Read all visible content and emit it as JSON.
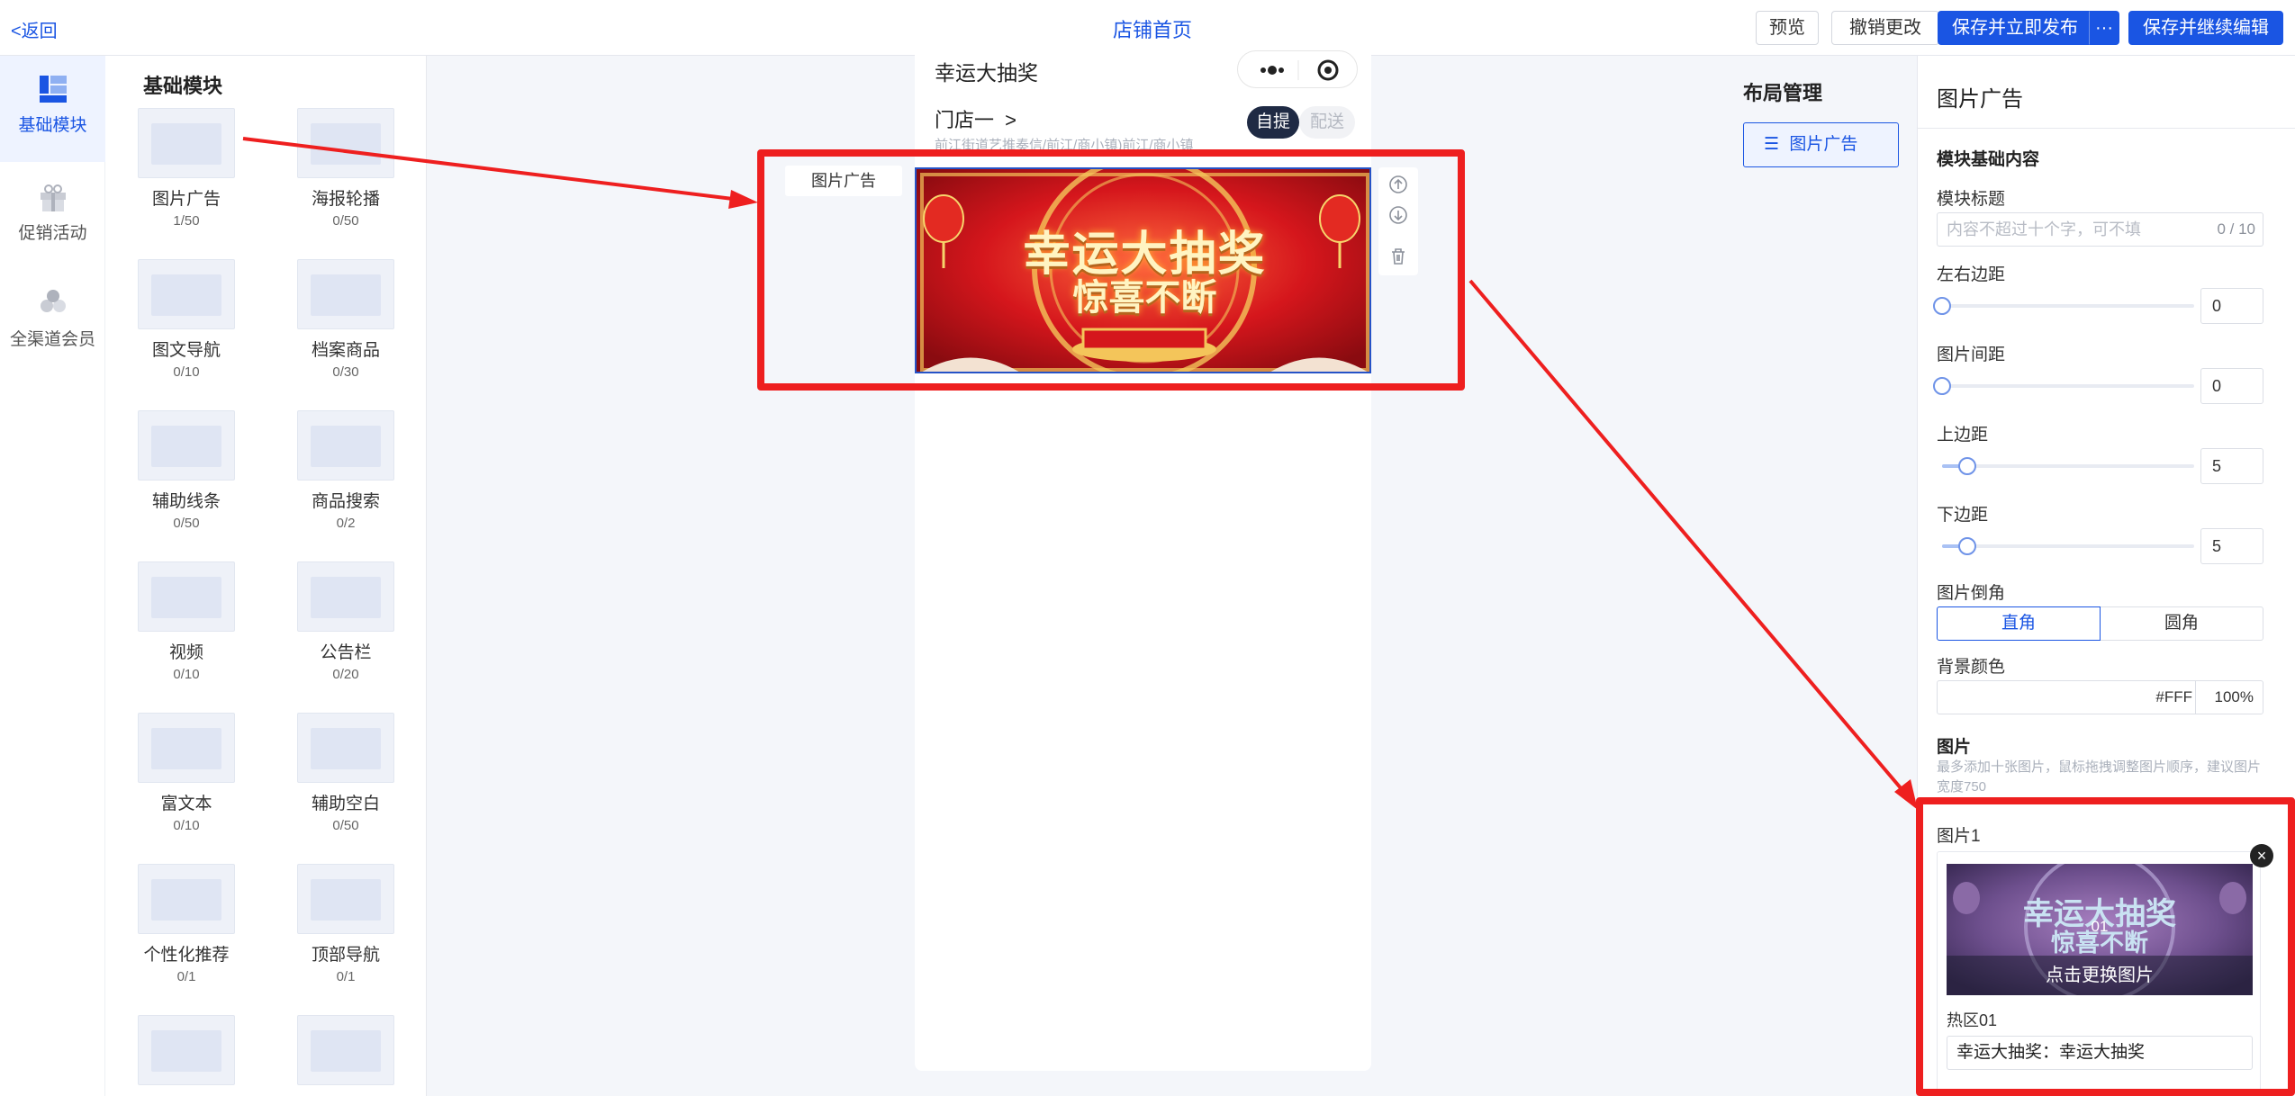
{
  "topbar": {
    "back": "<返回",
    "title": "店铺首页",
    "preview": "预览",
    "undo": "撤销更改",
    "save_publish": "保存并立即发布",
    "more": "···",
    "save_continue": "保存并继续编辑"
  },
  "rail": [
    {
      "label": "基础模块",
      "icon": "modules-icon"
    },
    {
      "label": "促销活动",
      "icon": "gift-icon"
    },
    {
      "label": "全渠道会员",
      "icon": "member-icon"
    }
  ],
  "modules": {
    "title": "基础模块",
    "items": [
      {
        "name": "图片广告",
        "count": "1/50"
      },
      {
        "name": "海报轮播",
        "count": "0/50"
      },
      {
        "name": "图文导航",
        "count": "0/10"
      },
      {
        "name": "档案商品",
        "count": "0/30"
      },
      {
        "name": "辅助线条",
        "count": "0/50"
      },
      {
        "name": "商品搜索",
        "count": "0/2"
      },
      {
        "name": "视频",
        "count": "0/10"
      },
      {
        "name": "公告栏",
        "count": "0/20"
      },
      {
        "name": "富文本",
        "count": "0/10"
      },
      {
        "name": "辅助空白",
        "count": "0/50"
      },
      {
        "name": "个性化推荐",
        "count": "0/1"
      },
      {
        "name": "顶部导航",
        "count": "0/1"
      },
      {
        "name": "",
        "count": ""
      },
      {
        "name": "",
        "count": ""
      }
    ]
  },
  "phone": {
    "title": "幸运大抽奖",
    "store": "门店一",
    "store_arrow": ">",
    "address": "前江街道艺推奏信/前江/商小镇)前江/商小镇",
    "pickup": "自提",
    "delivery": "配送",
    "ad_label": "图片广告",
    "banner_line1": "幸运大抽奖",
    "banner_line2": "惊喜不断"
  },
  "layout_manager": {
    "title": "布局管理",
    "item": "图片广告"
  },
  "settings": {
    "header": "图片广告",
    "section_basic": "模块基础内容",
    "module_title_label": "模块标题",
    "module_title_placeholder": "内容不超过十个字，可不填",
    "module_title_counter": "0 / 10",
    "lr_margin_label": "左右边距",
    "lr_margin_value": "0",
    "lr_margin_level": 0,
    "img_gap_label": "图片间距",
    "img_gap_value": "0",
    "img_gap_level": 0,
    "top_margin_label": "上边距",
    "top_margin_value": "5",
    "top_margin_level": 0.1,
    "bottom_margin_label": "下边距",
    "bottom_margin_value": "5",
    "bottom_margin_level": 0.1,
    "corner_label": "图片倒角",
    "corner_square": "直角",
    "corner_round": "圆角",
    "bg_label": "背景颜色",
    "bg_hex": "#FFF",
    "bg_opacity": "100%",
    "images_section": "图片",
    "images_hint": "最多添加十张图片，鼠标拖拽调整图片顺序，建议图片宽度750",
    "image1_label": "图片1",
    "image1_num": "01",
    "image1_change": "点击更换图片",
    "close": "×",
    "hotzone_label": "热区01",
    "hotzone_value": "幸运大抽奖：幸运大抽奖",
    "thumb_line1": "幸运大抽奖",
    "thumb_line2": "惊喜不断"
  },
  "colors": {
    "accent": "#1a55e3",
    "annotation": "#ee1f1f",
    "banner_red": "#c8151a",
    "banner_gold": "#f7d46b"
  }
}
